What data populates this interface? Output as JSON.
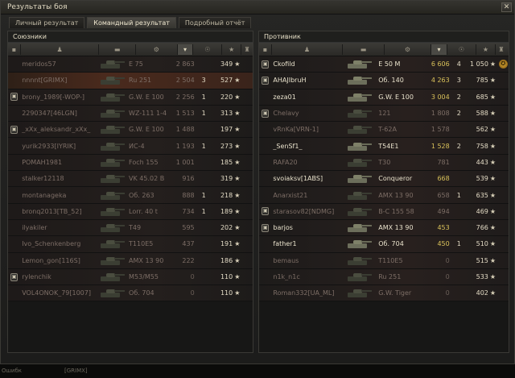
{
  "window": {
    "title": "Результаты боя",
    "close_glyph": "✕"
  },
  "tabs": [
    {
      "label": "Личный результат",
      "active": false
    },
    {
      "label": "Командный результат",
      "active": true
    },
    {
      "label": "Подробный отчёт",
      "active": false
    }
  ],
  "allies": {
    "title": "Союзники",
    "rows": [
      {
        "name": "meridos57",
        "tank": "E 75",
        "damage": "2 863",
        "kills": "",
        "exp": "349",
        "state": "dead",
        "me": false,
        "platoon": false
      },
      {
        "name": "nnnnt[GRIMX]",
        "tank": "Ru 251",
        "damage": "2 504",
        "kills": "3",
        "exp": "527",
        "state": "dead",
        "me": true,
        "platoon": false
      },
      {
        "name": "brony_1989[-WOP-]",
        "tank": "G.W. E 100",
        "damage": "2 256",
        "kills": "1",
        "exp": "220",
        "state": "dead",
        "me": false,
        "platoon": true
      },
      {
        "name": "2290347[46LGN]",
        "tank": "WZ-111 1-4",
        "damage": "1 513",
        "kills": "1",
        "exp": "313",
        "state": "dead",
        "me": false,
        "platoon": false
      },
      {
        "name": "_xXx_aleksandr_xXx_",
        "tank": "G.W. E 100",
        "damage": "1 488",
        "kills": "",
        "exp": "197",
        "state": "dead",
        "me": false,
        "platoon": true
      },
      {
        "name": "yurik2933[IYRIK]",
        "tank": "ИС-4",
        "damage": "1 193",
        "kills": "1",
        "exp": "273",
        "state": "dead",
        "me": false,
        "platoon": false
      },
      {
        "name": "POMAH1981",
        "tank": "Foch 155",
        "damage": "1 001",
        "kills": "",
        "exp": "185",
        "state": "dead",
        "me": false,
        "platoon": false
      },
      {
        "name": "stalker12118",
        "tank": "VK 45.02 B",
        "damage": "916",
        "kills": "",
        "exp": "319",
        "state": "dead",
        "me": false,
        "platoon": false
      },
      {
        "name": "montanageka",
        "tank": "Об. 263",
        "damage": "888",
        "kills": "1",
        "exp": "218",
        "state": "dead",
        "me": false,
        "platoon": false
      },
      {
        "name": "bronq2013[TB_52]",
        "tank": "Lorr. 40 t",
        "damage": "734",
        "kills": "1",
        "exp": "189",
        "state": "dead",
        "me": false,
        "platoon": false
      },
      {
        "name": "ilyakiler",
        "tank": "T49",
        "damage": "595",
        "kills": "",
        "exp": "202",
        "state": "dead",
        "me": false,
        "platoon": false
      },
      {
        "name": "Ivo_Schenkenberg",
        "tank": "T110E5",
        "damage": "437",
        "kills": "",
        "exp": "191",
        "state": "dead",
        "me": false,
        "platoon": false
      },
      {
        "name": "Lemon_gon[116S]",
        "tank": "AMX 13 90",
        "damage": "222",
        "kills": "",
        "exp": "186",
        "state": "dead",
        "me": false,
        "platoon": false
      },
      {
        "name": "rylenchik",
        "tank": "M53/M55",
        "damage": "0",
        "kills": "",
        "exp": "110",
        "state": "dead",
        "me": false,
        "platoon": true
      },
      {
        "name": "VOL4ONOK_79[1007]",
        "tank": "Об. 704",
        "damage": "0",
        "kills": "",
        "exp": "110",
        "state": "dead",
        "me": false,
        "platoon": false
      }
    ]
  },
  "enemies": {
    "title": "Противник",
    "rows": [
      {
        "name": "Ckofild",
        "tank": "E 50 M",
        "damage": "6 606",
        "kills": "4",
        "exp": "1 050",
        "state": "alive",
        "platoon": true,
        "badge": true
      },
      {
        "name": "AHAJIbruH",
        "tank": "Об. 140",
        "damage": "4 263",
        "kills": "3",
        "exp": "785",
        "state": "alive",
        "platoon": true,
        "badge": false
      },
      {
        "name": "zeza01",
        "tank": "G.W. E 100",
        "damage": "3 004",
        "kills": "2",
        "exp": "685",
        "state": "alive",
        "platoon": false,
        "badge": false
      },
      {
        "name": "Chelavy",
        "tank": "121",
        "damage": "1 808",
        "kills": "2",
        "exp": "588",
        "state": "dead",
        "platoon": true,
        "badge": false
      },
      {
        "name": "vRnKa[VRN-1]",
        "tank": "T-62A",
        "damage": "1 578",
        "kills": "",
        "exp": "562",
        "state": "dead",
        "platoon": false,
        "badge": false
      },
      {
        "name": "_SenSf1_",
        "tank": "T54E1",
        "damage": "1 528",
        "kills": "2",
        "exp": "758",
        "state": "alive",
        "platoon": false,
        "badge": false
      },
      {
        "name": "RAFA20",
        "tank": "T30",
        "damage": "781",
        "kills": "",
        "exp": "443",
        "state": "dead",
        "platoon": false,
        "badge": false
      },
      {
        "name": "svoiaksv[1ABS]",
        "tank": "Conqueror",
        "damage": "668",
        "kills": "",
        "exp": "539",
        "state": "alive",
        "platoon": false,
        "badge": false
      },
      {
        "name": "Anarxist21",
        "tank": "AMX 13 90",
        "damage": "658",
        "kills": "1",
        "exp": "635",
        "state": "dead",
        "platoon": false,
        "badge": false
      },
      {
        "name": "starasov82[NDMG]",
        "tank": "B-C 155 58",
        "damage": "494",
        "kills": "",
        "exp": "469",
        "state": "dead",
        "platoon": true,
        "badge": false
      },
      {
        "name": "barjos",
        "tank": "AMX 13 90",
        "damage": "453",
        "kills": "",
        "exp": "766",
        "state": "alive",
        "platoon": true,
        "badge": false
      },
      {
        "name": "father1",
        "tank": "Об. 704",
        "damage": "450",
        "kills": "1",
        "exp": "510",
        "state": "alive",
        "platoon": false,
        "badge": false
      },
      {
        "name": "bemaus",
        "tank": "T110E5",
        "damage": "0",
        "kills": "",
        "exp": "515",
        "state": "dead",
        "platoon": false,
        "badge": false
      },
      {
        "name": "n1k_n1c",
        "tank": "Ru 251",
        "damage": "0",
        "kills": "",
        "exp": "533",
        "state": "dead",
        "platoon": false,
        "badge": false
      },
      {
        "name": "Roman332[UA_ML]",
        "tank": "G.W. Tiger",
        "damage": "0",
        "kills": "",
        "exp": "402",
        "state": "dead",
        "platoon": false,
        "badge": false
      }
    ]
  },
  "icons": {
    "star": "★",
    "platoon": "▣",
    "badge": "medal-icon"
  },
  "bottom": {
    "left_text": "Ошибк",
    "mid_text": "[GRIMX]"
  }
}
